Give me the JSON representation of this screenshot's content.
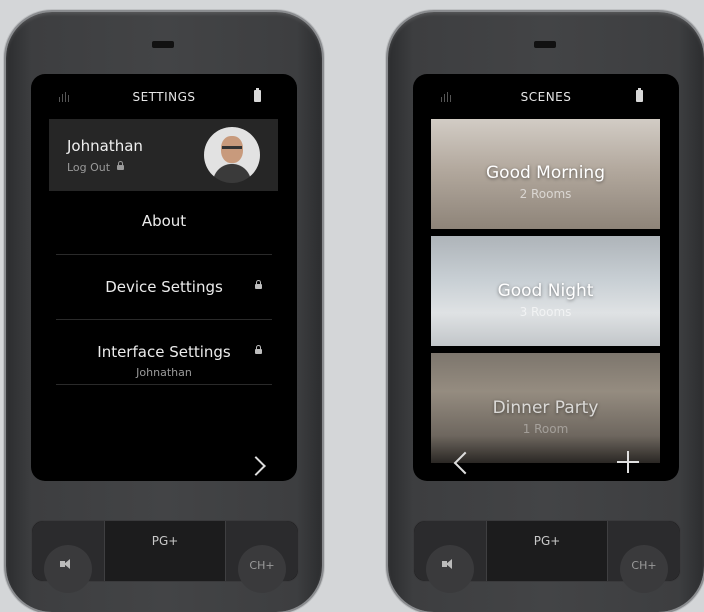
{
  "settings_screen": {
    "title": "SETTINGS",
    "user": {
      "name": "Johnathan",
      "logout_label": "Log Out"
    },
    "menu": [
      {
        "label": "About"
      },
      {
        "label": "Device Settings",
        "locked": true
      },
      {
        "label": "Interface Settings",
        "sublabel": "Johnathan",
        "locked": true
      }
    ],
    "icons": [
      "signal-icon",
      "battery-icon",
      "lock-icon",
      "chevron-right-icon"
    ]
  },
  "scenes_screen": {
    "title": "SCENES",
    "scenes": [
      {
        "name": "Good Morning",
        "rooms": "2 Rooms",
        "bg_color": "#b8aea3"
      },
      {
        "name": "Good Night",
        "rooms": "3 Rooms",
        "bg_color": "#b9c3cb"
      },
      {
        "name": "Dinner Party",
        "rooms": "1 Room",
        "bg_color": "#8d867c"
      }
    ],
    "icons": [
      "signal-icon",
      "battery-icon",
      "chevron-left-icon",
      "plus-icon"
    ]
  },
  "button_pad": {
    "page_label": "PG+",
    "channel_label": "CH+",
    "icons": [
      "volume-icon"
    ]
  },
  "colors": {
    "background": "#d4d6d8",
    "device_body": "#434446",
    "screen": "#000000",
    "user_card": "#262626"
  }
}
